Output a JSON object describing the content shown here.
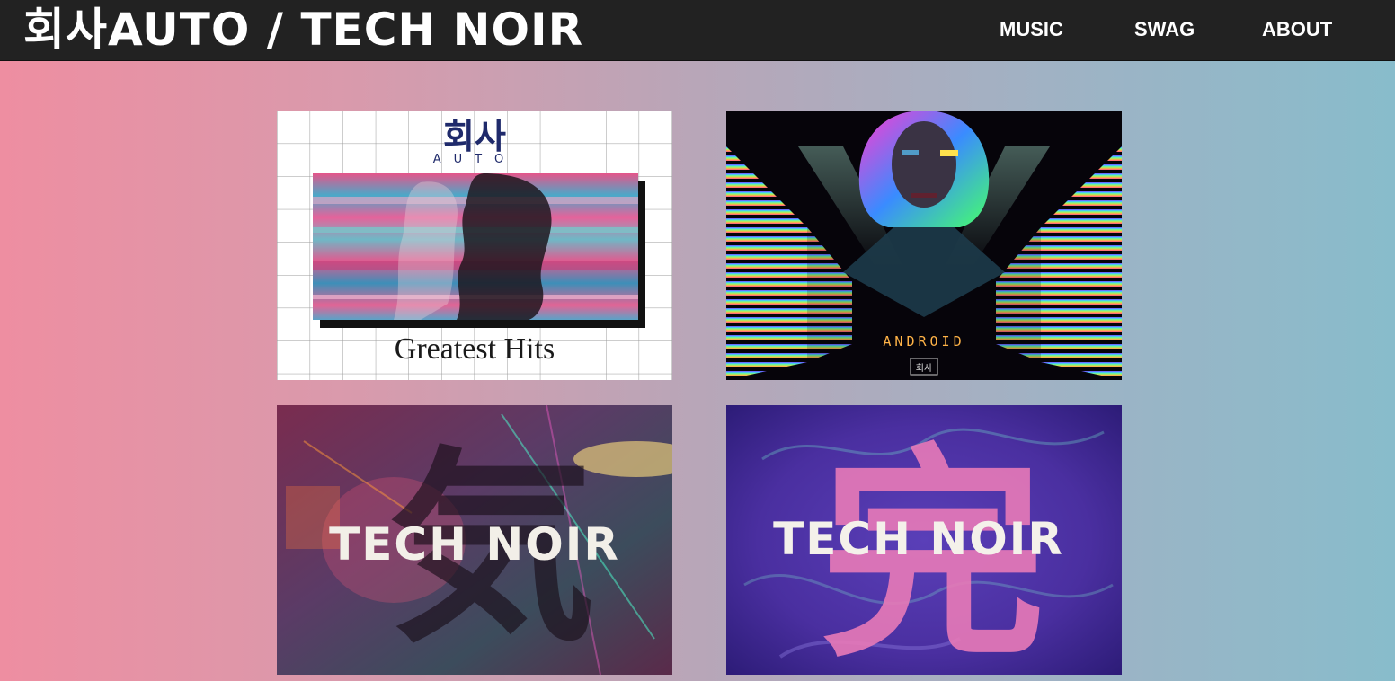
{
  "header": {
    "title": "회사AUTO / TECH NOIR",
    "nav": [
      {
        "label": "MUSIC"
      },
      {
        "label": "SWAG"
      },
      {
        "label": "ABOUT"
      }
    ]
  },
  "albums": [
    {
      "art_logo": "회사",
      "art_logo_sub": "AUTO",
      "art_caption": "Greatest Hits"
    },
    {
      "art_title": "ANDROID",
      "art_logo": "회사"
    },
    {
      "art_title": "TECH NOIR",
      "art_glyph": "気"
    },
    {
      "art_title": "TECH NOIR",
      "art_glyph": "完"
    }
  ]
}
